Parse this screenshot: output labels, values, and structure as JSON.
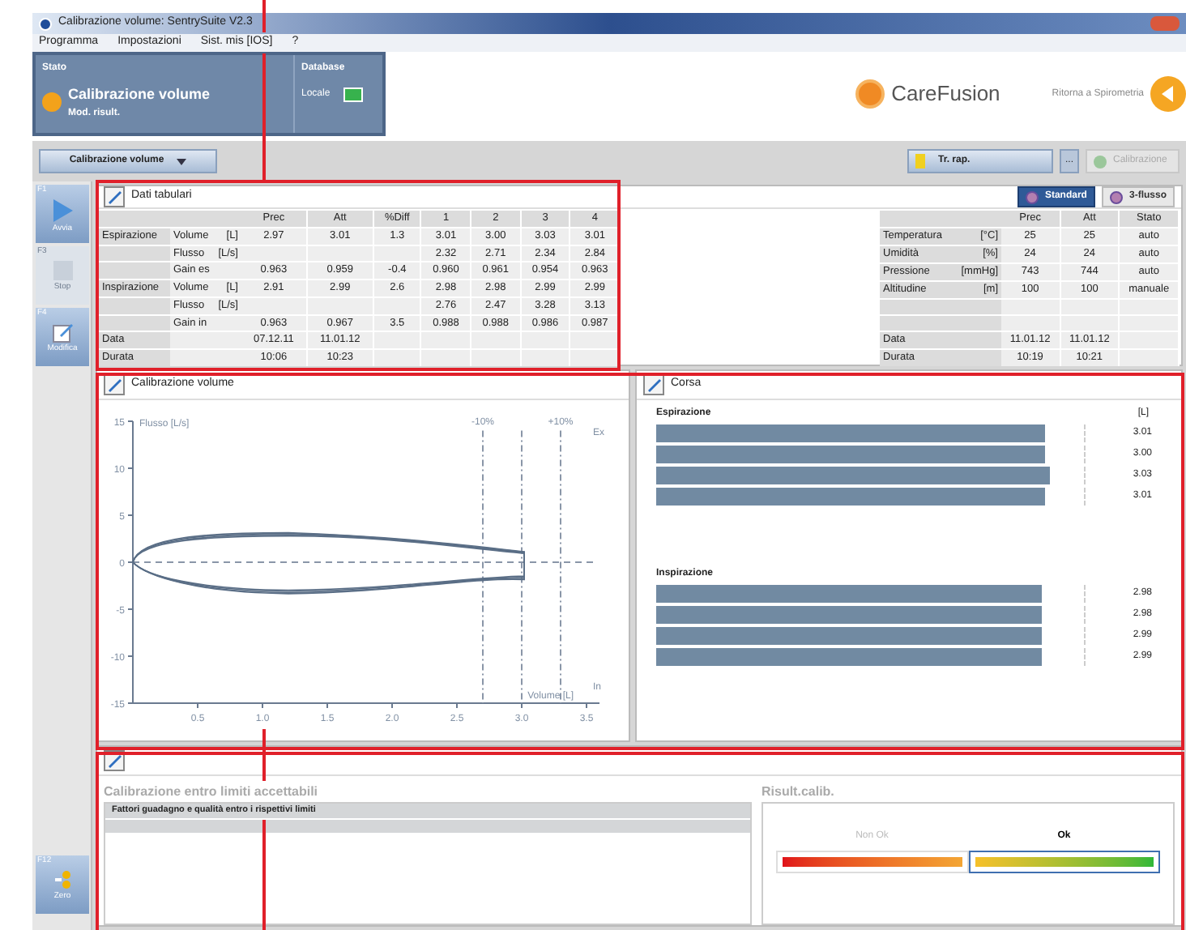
{
  "window": {
    "title": "Calibrazione volume: SentrySuite  V2.3"
  },
  "menu": [
    "Programma",
    "Impostazioni",
    "Sist. mis [IOS]",
    "?"
  ],
  "status": {
    "label": "Stato",
    "title": "Calibrazione volume",
    "subtitle": "Mod. risult.",
    "db_label": "Database",
    "db_value": "Locale"
  },
  "brand": {
    "logo_text": "CareFusion",
    "back_label": "Ritorna a Spirometria"
  },
  "toolbar": {
    "mode_select": "Calibrazione volume",
    "report_button": "Tr. rap.",
    "more_button": "...",
    "calibration_button": {
      "label": "Calibrazione",
      "disabled": true
    }
  },
  "function_keys": [
    {
      "key": "F1",
      "label": "Avvia",
      "disabled": false,
      "kind": "play"
    },
    {
      "key": "F3",
      "label": "Stop",
      "disabled": true,
      "kind": "stop"
    },
    {
      "key": "F4",
      "label": "Modifica",
      "disabled": false,
      "kind": "edit"
    },
    {
      "key": "F12",
      "label": "Zero",
      "disabled": false,
      "kind": "zero"
    }
  ],
  "tabular": {
    "title": "Dati tabulari",
    "modes": [
      {
        "label": "Standard",
        "selected": true
      },
      {
        "label": "3-flusso",
        "selected": false
      }
    ],
    "columns": [
      "Prec",
      "Att",
      "%Diff",
      "1",
      "2",
      "3",
      "4"
    ],
    "rows": [
      {
        "group": "Espirazione",
        "param": "Volume",
        "unit": "[L]",
        "cells": [
          "2.97",
          "3.01",
          "1.3",
          "3.01",
          "3.00",
          "3.03",
          "3.01"
        ]
      },
      {
        "group": "",
        "param": "Flusso",
        "unit": "[L/s]",
        "cells": [
          "",
          "",
          "",
          "2.32",
          "2.71",
          "2.34",
          "2.84"
        ]
      },
      {
        "group": "",
        "param": "Gain es",
        "unit": "",
        "cells": [
          "0.963",
          "0.959",
          "-0.4",
          "0.960",
          "0.961",
          "0.954",
          "0.963"
        ]
      },
      {
        "group": "Inspirazione",
        "param": "Volume",
        "unit": "[L]",
        "cells": [
          "2.91",
          "2.99",
          "2.6",
          "2.98",
          "2.98",
          "2.99",
          "2.99"
        ]
      },
      {
        "group": "",
        "param": "Flusso",
        "unit": "[L/s]",
        "cells": [
          "",
          "",
          "",
          "2.76",
          "2.47",
          "3.28",
          "3.13"
        ]
      },
      {
        "group": "",
        "param": "Gain in",
        "unit": "",
        "cells": [
          "0.963",
          "0.967",
          "3.5",
          "0.988",
          "0.988",
          "0.986",
          "0.987"
        ]
      },
      {
        "group": "Data",
        "param": "",
        "unit": "",
        "cells": [
          "07.12.11",
          "11.01.12",
          "",
          "",
          "",
          "",
          ""
        ]
      },
      {
        "group": "Durata",
        "param": "",
        "unit": "",
        "cells": [
          "10:06",
          "10:23",
          "",
          "",
          "",
          "",
          ""
        ]
      }
    ],
    "env_columns": [
      "Prec",
      "Att",
      "Stato"
    ],
    "env_rows": [
      {
        "param": "Temperatura",
        "unit": "[°C]",
        "cells": [
          "25",
          "25",
          "auto"
        ]
      },
      {
        "param": "Umidità",
        "unit": "[%]",
        "cells": [
          "24",
          "24",
          "auto"
        ]
      },
      {
        "param": "Pressione",
        "unit": "[mmHg]",
        "cells": [
          "743",
          "744",
          "auto"
        ]
      },
      {
        "param": "Altitudine",
        "unit": "[m]",
        "cells": [
          "100",
          "100",
          "manuale"
        ]
      },
      {
        "param": "",
        "unit": "",
        "cells": [
          "",
          "",
          ""
        ]
      },
      {
        "param": "",
        "unit": "",
        "cells": [
          "",
          "",
          ""
        ]
      },
      {
        "param": "Data",
        "unit": "",
        "cells": [
          "11.01.12",
          "11.01.12",
          ""
        ]
      },
      {
        "param": "Durata",
        "unit": "",
        "cells": [
          "10:19",
          "10:21",
          ""
        ]
      }
    ]
  },
  "loop_plot": {
    "title": "Calibrazione volume",
    "y_label": "Flusso [L/s]",
    "x_label": "Volume [L]",
    "y_ticks": [
      "15",
      "10",
      "5",
      "0",
      "-5",
      "-10",
      "-15"
    ],
    "x_ticks": [
      "0.5",
      "1.0",
      "1.5",
      "2.0",
      "2.5",
      "3.0",
      "3.5"
    ],
    "minus_label": "-10%",
    "plus_label": "+10%",
    "ex_label": "Ex",
    "in_label": "In"
  },
  "strokes": {
    "title": "Corsa",
    "unit": "[L]",
    "groups": [
      {
        "label": "Espirazione",
        "bars": [
          {
            "value": "3.01",
            "level": 0.91
          },
          {
            "value": "3.00",
            "level": 0.91
          },
          {
            "value": "3.03",
            "level": 0.92
          },
          {
            "value": "3.01",
            "level": 0.91
          }
        ]
      },
      {
        "label": "Inspirazione",
        "bars": [
          {
            "value": "2.98",
            "level": 0.9
          },
          {
            "value": "2.98",
            "level": 0.9
          },
          {
            "value": "2.99",
            "level": 0.9
          },
          {
            "value": "2.99",
            "level": 0.9
          }
        ]
      }
    ]
  },
  "result": {
    "heading": "Calibrazione entro limiti accettabili",
    "messages": [
      "Fattori guadagno e qualità entro i rispettivi limiti"
    ],
    "result_heading": "Risult.calib.",
    "scale": [
      {
        "label": "Non Ok",
        "selected": false
      },
      {
        "label": "Ok",
        "selected": true
      }
    ]
  }
}
